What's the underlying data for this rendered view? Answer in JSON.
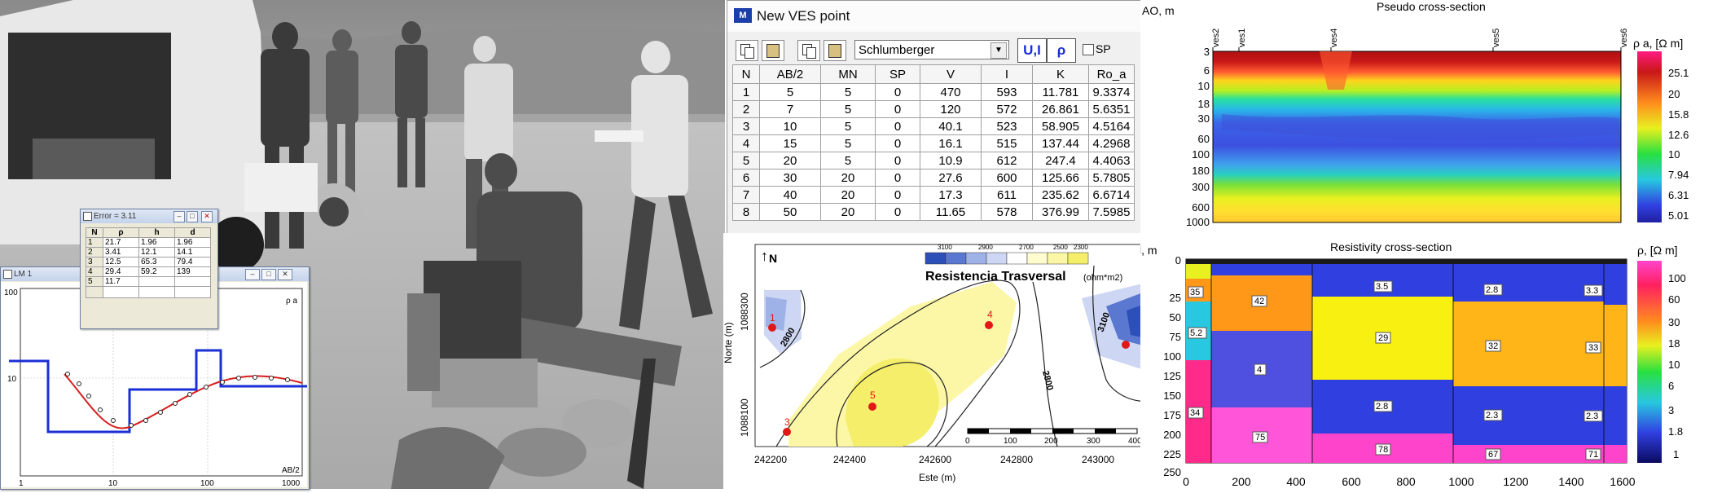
{
  "lm1": {
    "title": "LM 1",
    "y_top": "100",
    "y_mid": "10",
    "y_axis": "ρ a",
    "x_ticks": [
      "1",
      "10",
      "100",
      "1000"
    ],
    "x_axis": "AB/2"
  },
  "error_window": {
    "title": "Error = 3.11",
    "headers": [
      "N",
      "ρ",
      "h",
      "d"
    ],
    "rows": [
      [
        "1",
        "21.7",
        "1.96",
        "1.96"
      ],
      [
        "2",
        "3.41",
        "12.1",
        "14.1"
      ],
      [
        "3",
        "12.5",
        "65.3",
        "79.4"
      ],
      [
        "4",
        "29.4",
        "59.2",
        "139"
      ],
      [
        "5",
        "11.7",
        "",
        ""
      ],
      [
        "",
        "",
        "",
        ""
      ]
    ]
  },
  "ves": {
    "title": "New VES point",
    "array_type": "Schlumberger",
    "btn_ui": "U,I",
    "btn_rho": "ρ",
    "checkbox_label": "SP",
    "headers": [
      "N",
      "AB/2",
      "MN",
      "SP",
      "V",
      "I",
      "K",
      "Ro_a"
    ],
    "rows": [
      [
        "1",
        "5",
        "5",
        "0",
        "470",
        "593",
        "11.781",
        "9.3374"
      ],
      [
        "2",
        "7",
        "5",
        "0",
        "120",
        "572",
        "26.861",
        "5.6351"
      ],
      [
        "3",
        "10",
        "5",
        "0",
        "40.1",
        "523",
        "58.905",
        "4.5164"
      ],
      [
        "4",
        "15",
        "5",
        "0",
        "16.1",
        "515",
        "137.44",
        "4.2968"
      ],
      [
        "5",
        "20",
        "5",
        "0",
        "10.9",
        "612",
        "247.4",
        "4.4063"
      ],
      [
        "6",
        "30",
        "20",
        "0",
        "27.6",
        "600",
        "125.66",
        "5.7805"
      ],
      [
        "7",
        "40",
        "20",
        "0",
        "17.3",
        "611",
        "235.62",
        "6.6714"
      ],
      [
        "8",
        "50",
        "20",
        "0",
        "11.65",
        "578",
        "376.99",
        "7.5985"
      ]
    ]
  },
  "map": {
    "north": "N",
    "title": "Resistencia Trasversal",
    "unit": "(ohm*m2)",
    "legend_ticks": [
      "3100",
      "2900",
      "2700",
      "2500",
      "2300"
    ],
    "legend_colors": [
      "#2d50b8",
      "#5a78d0",
      "#9fb2e8",
      "#cdd6f3",
      "#ffffff",
      "#fffcd0",
      "#fcf7a6",
      "#f5ee6a"
    ],
    "ylabel": "Norte (m)",
    "xlabel": "Este (m)",
    "y_ticks": [
      "1088300",
      "1088100"
    ],
    "x_ticks": [
      "242200",
      "242400",
      "242600",
      "242800",
      "243000"
    ],
    "scale_ticks": [
      "0",
      "100",
      "200",
      "300",
      "400"
    ],
    "contour_labels": [
      "2800",
      "2800",
      "3100"
    ],
    "points": [
      {
        "label": "1",
        "x": 242195,
        "y": 1088290
      },
      {
        "label": "3",
        "x": 242215,
        "y": 1088010
      },
      {
        "label": "5",
        "x": 242430,
        "y": 1088070
      },
      {
        "label": "4",
        "x": 242700,
        "y": 1088290
      },
      {
        "label": "",
        "x": 243080,
        "y": 1088260
      }
    ]
  },
  "pseudo": {
    "title": "Pseudo cross-section",
    "ylabel": "AO, m",
    "y_ticks": [
      "3",
      "6",
      "10",
      "18",
      "30",
      "60",
      "100",
      "180",
      "300",
      "600",
      "1000"
    ],
    "stations": [
      "ves2",
      "ves1",
      "ves4",
      "ves5",
      "ves6"
    ],
    "unit": "ρ a, [Ω m]",
    "scale": [
      "25.1",
      "20",
      "15.8",
      "12.6",
      "10",
      "7.94",
      "6.31",
      "5.01"
    ]
  },
  "resist": {
    "title": "Resistivity cross-section",
    "unit": "ρ, [Ω m]",
    "y_label": "l, m",
    "y_ticks": [
      "0",
      "25",
      "50",
      "75",
      "100",
      "125",
      "150",
      "175",
      "200",
      "225",
      "250"
    ],
    "x_ticks": [
      "0",
      "200",
      "400",
      "600",
      "800",
      "1000",
      "1200",
      "1400",
      "1600"
    ],
    "scale": [
      "100",
      "60",
      "30",
      "18",
      "10",
      "6",
      "3",
      "1.8",
      "1"
    ],
    "labels": [
      "35",
      "42",
      "5.2",
      "4",
      "34",
      "75",
      "3.5",
      "29",
      "2.8",
      "78",
      "2.8",
      "32",
      "2.3",
      "67",
      "3.3",
      "33",
      "2.3",
      "71"
    ]
  }
}
